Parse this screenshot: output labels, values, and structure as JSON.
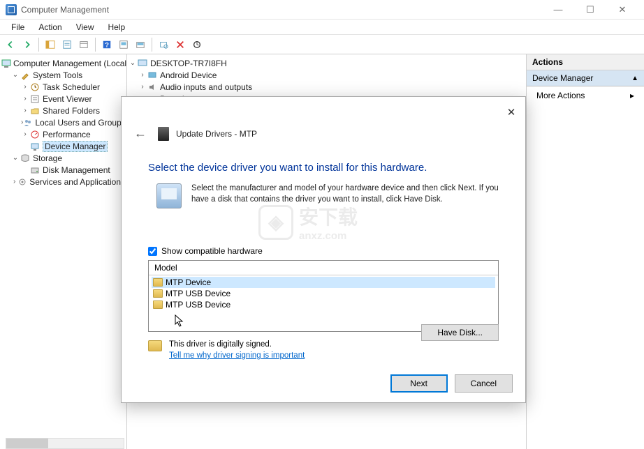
{
  "window": {
    "title": "Computer Management",
    "minimize": "—",
    "maximize": "☐",
    "close": "✕"
  },
  "menu": {
    "file": "File",
    "action": "Action",
    "view": "View",
    "help": "Help"
  },
  "tree": {
    "root": "Computer Management (Local)",
    "systools": "System Tools",
    "st_items": {
      "task": "Task Scheduler",
      "event": "Event Viewer",
      "shared": "Shared Folders",
      "users": "Local Users and Groups",
      "perf": "Performance",
      "devmgr": "Device Manager"
    },
    "storage": "Storage",
    "diskmgmt": "Disk Management",
    "services": "Services and Applications"
  },
  "devtree": {
    "host": "DESKTOP-TR7I8FH",
    "d1": "Android Device",
    "d2": "Audio inputs and outputs",
    "d3": "Batteries"
  },
  "actions": {
    "header": "Actions",
    "section": "Device Manager",
    "more": "More Actions"
  },
  "dialog": {
    "title": "Update Drivers - MTP",
    "headline": "Select the device driver you want to install for this hardware.",
    "instructions": "Select the manufacturer and model of your hardware device and then click Next. If you have a disk that contains the driver you want to install, click Have Disk.",
    "checkbox": "Show compatible hardware",
    "model_header": "Model",
    "drivers": [
      "MTP Device",
      "MTP USB Device",
      "MTP USB Device"
    ],
    "signed": "This driver is digitally signed.",
    "sign_link": "Tell me why driver signing is important",
    "have_disk": "Have Disk...",
    "next": "Next",
    "cancel": "Cancel"
  },
  "watermark": {
    "text": "安下载",
    "sub": "anxz.com"
  }
}
